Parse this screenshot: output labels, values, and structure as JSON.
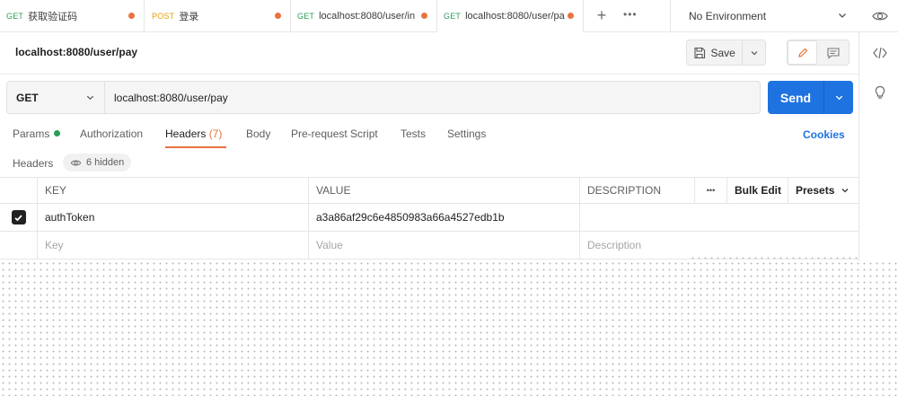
{
  "tabs": [
    {
      "method": "GET",
      "name": "获取验证码",
      "modified": true
    },
    {
      "method": "POST",
      "name": "登录",
      "modified": true
    },
    {
      "method": "GET",
      "name": "localhost:8080/user/in",
      "modified": true
    },
    {
      "method": "GET",
      "name": "localhost:8080/user/pa",
      "modified": true,
      "active": true
    }
  ],
  "tab_actions": {
    "new_icon": "plus-icon",
    "more_icon": "more-horizontal-icon"
  },
  "environment": {
    "selected": "No Environment"
  },
  "request": {
    "title": "localhost:8080/user/pay",
    "method": "GET",
    "url": "localhost:8080/user/pay"
  },
  "toolbar": {
    "save_label": "Save",
    "send_label": "Send"
  },
  "subtabs": [
    {
      "label": "Params"
    },
    {
      "label": "Authorization"
    },
    {
      "label": "Headers",
      "count": "(7)"
    },
    {
      "label": "Body"
    },
    {
      "label": "Pre-request Script"
    },
    {
      "label": "Tests"
    },
    {
      "label": "Settings"
    }
  ],
  "cookies_label": "Cookies",
  "headers_section": {
    "label": "Headers",
    "hidden_label": "6 hidden"
  },
  "table": {
    "columns": {
      "key": "KEY",
      "value": "VALUE",
      "description": "DESCRIPTION",
      "more": "•••",
      "bulk_edit": "Bulk Edit",
      "presets": "Presets"
    },
    "rows": [
      {
        "checked": true,
        "key": "authToken",
        "value": "a3a86af29c6e4850983a66a4527edb1b",
        "description": ""
      }
    ],
    "placeholder": {
      "key": "Key",
      "value": "Value",
      "description": "Description"
    }
  },
  "colors": {
    "accent": "#1f73e0",
    "active_tab": "#e8733e",
    "get": "#2a9d5b",
    "post": "#e3a008"
  }
}
